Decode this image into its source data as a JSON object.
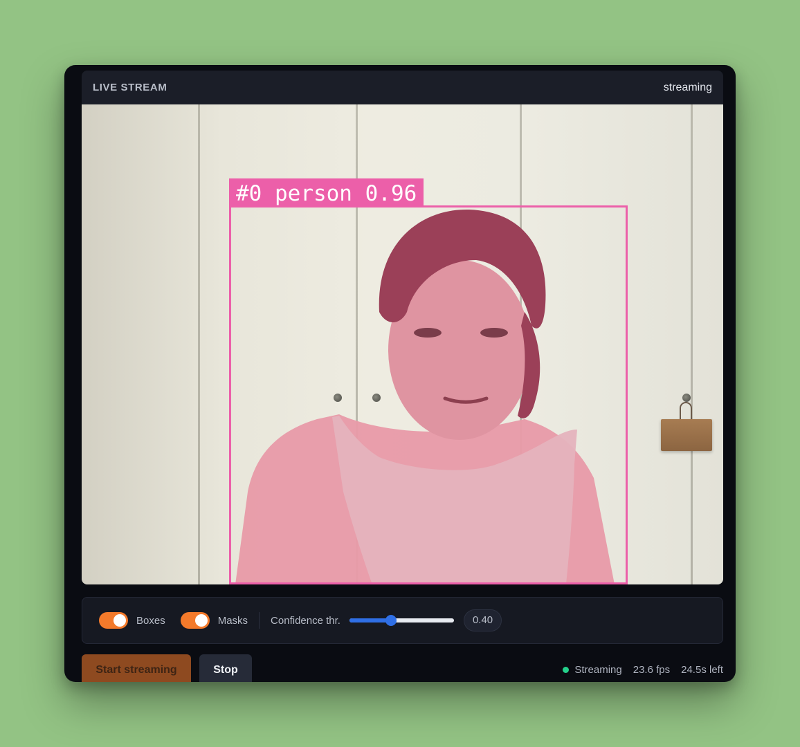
{
  "stream": {
    "title": "LIVE STREAM",
    "status": "streaming"
  },
  "detection": {
    "label": "#0 person 0.96",
    "color": "#ec5fa9"
  },
  "controls": {
    "boxes_label": "Boxes",
    "boxes_on": true,
    "masks_label": "Masks",
    "masks_on": true,
    "confidence_label": "Confidence thr.",
    "confidence_value": "0.40",
    "confidence_fraction": 0.4
  },
  "actions": {
    "start_label": "Start streaming",
    "stop_label": "Stop"
  },
  "status": {
    "state": "Streaming",
    "fps": "23.6 fps",
    "time_left": "24.5s left"
  },
  "colors": {
    "accent_orange": "#f37a2b",
    "slider_blue": "#2f6fe6",
    "status_green": "#24d18b",
    "page_background": "#93c384"
  }
}
